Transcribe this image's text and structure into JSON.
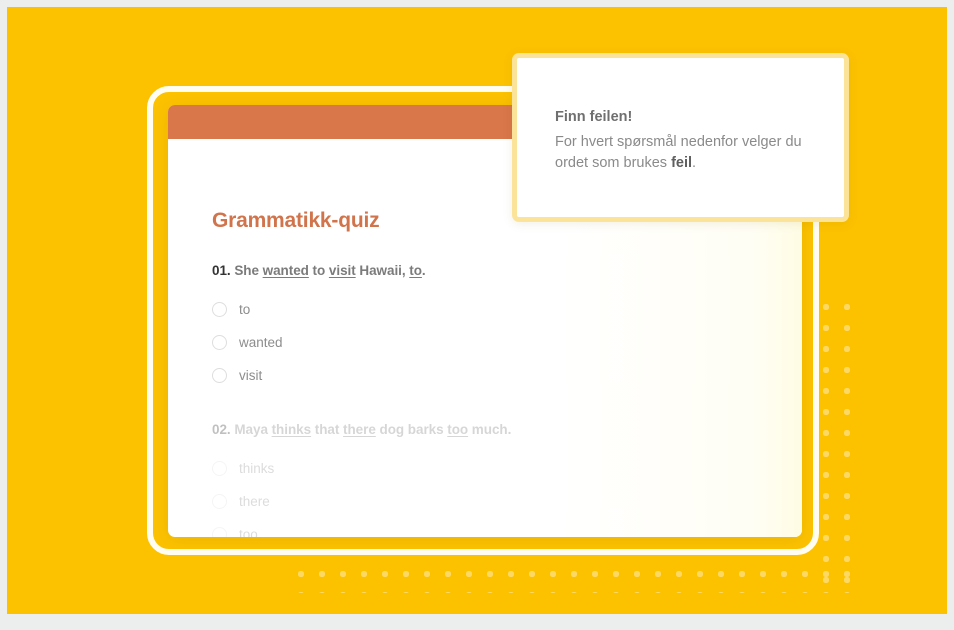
{
  "colors": {
    "page_background": "#fcc200",
    "outer_border": "#eceded",
    "card_header": "#d9764a",
    "title": "#d1744c",
    "dots": "#fdd964",
    "callout_border": "#fbe49a",
    "frame": "#fffdf2"
  },
  "quiz": {
    "title": "Grammatikk-quiz",
    "questions": [
      {
        "number": "01.",
        "sentence_parts": [
          {
            "text": "She ",
            "underline": false
          },
          {
            "text": "wanted",
            "underline": true
          },
          {
            "text": " to ",
            "underline": false
          },
          {
            "text": "visit",
            "underline": true
          },
          {
            "text": " Hawaii, ",
            "underline": false
          },
          {
            "text": "to",
            "underline": true
          },
          {
            "text": ".",
            "underline": false
          }
        ],
        "options": [
          "to",
          "wanted",
          "visit"
        ],
        "dimmed": false
      },
      {
        "number": "02.",
        "sentence_parts": [
          {
            "text": "Maya ",
            "underline": false
          },
          {
            "text": "thinks",
            "underline": true
          },
          {
            "text": " that ",
            "underline": false
          },
          {
            "text": "there",
            "underline": true
          },
          {
            "text": " dog barks ",
            "underline": false
          },
          {
            "text": "too",
            "underline": true
          },
          {
            "text": " much.",
            "underline": false
          }
        ],
        "options": [
          "thinks",
          "there",
          "too"
        ],
        "dimmed": true
      }
    ]
  },
  "callout": {
    "title": "Finn feilen!",
    "body_parts": [
      {
        "text": "For hvert spørsmål nedenfor velger du ordet som brukes ",
        "bold": false
      },
      {
        "text": "feil",
        "bold": true
      },
      {
        "text": ".",
        "bold": false
      }
    ]
  }
}
